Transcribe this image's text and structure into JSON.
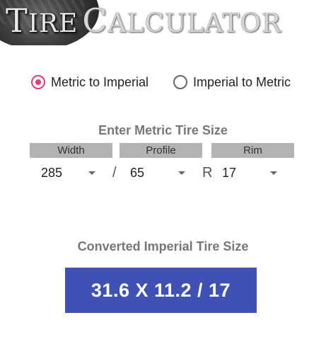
{
  "header": {
    "logo_word1_initial": "T",
    "logo_word1_rest": "IRE",
    "logo_word2_initial": "C",
    "logo_word2_rest": "ALCULATOR"
  },
  "conversion_mode": {
    "options": [
      {
        "label": "Metric to Imperial",
        "selected": true
      },
      {
        "label": "Imperial to Metric",
        "selected": false
      }
    ]
  },
  "input_section": {
    "title": "Enter Metric Tire Size",
    "columns": [
      "Width",
      "Profile",
      "Rim"
    ],
    "width_value": "285",
    "profile_value": "65",
    "rim_value": "17",
    "separator_slash": "/",
    "separator_r": "R"
  },
  "result_section": {
    "title": "Converted Imperial Tire Size",
    "value": "31.6 X 11.2 / 17"
  },
  "colors": {
    "accent_radio": "#e33d74",
    "result_bg": "#3f51b5",
    "column_header_bg": "#b3b3b3"
  }
}
